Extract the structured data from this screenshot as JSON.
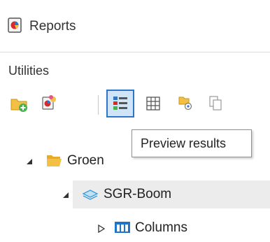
{
  "window": {
    "title": "Reports"
  },
  "section": {
    "label": "Utilities"
  },
  "toolbar": {
    "buttons": [
      {
        "name": "add-folder",
        "icon": "folder-plus-icon"
      },
      {
        "name": "add-report",
        "icon": "report-color-icon"
      },
      {
        "name": "preview-results",
        "icon": "list-view-icon",
        "active": true
      },
      {
        "name": "grid-view",
        "icon": "grid-icon"
      },
      {
        "name": "tag-item",
        "icon": "tag-icon"
      },
      {
        "name": "copy",
        "icon": "copy-icon"
      }
    ],
    "tooltip": "Preview results"
  },
  "tree": {
    "nodes": [
      {
        "label": "Groen",
        "icon": "folder-icon",
        "expanded": true
      },
      {
        "label": "SGR-Boom",
        "icon": "table-layer-icon",
        "expanded": true,
        "selected": true
      },
      {
        "label": "Columns",
        "icon": "columns-icon",
        "expanded": false
      }
    ]
  },
  "colors": {
    "accent": "#2e77c8",
    "folder": "#f3c046",
    "selection": "#ececec"
  }
}
